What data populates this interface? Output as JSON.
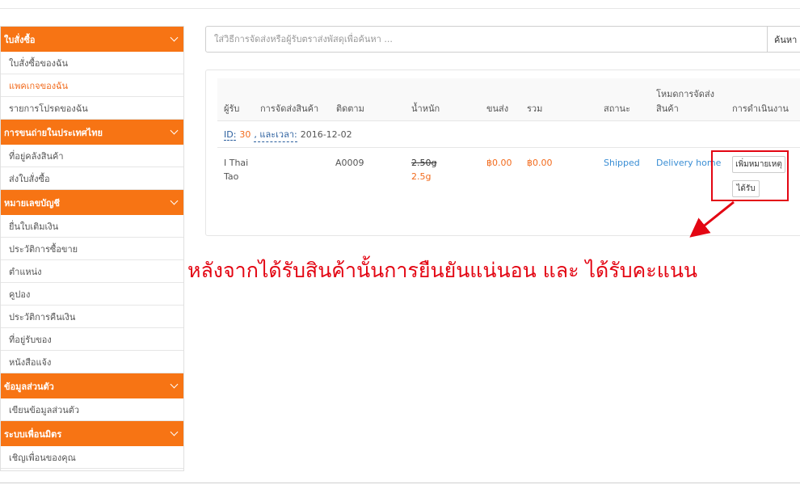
{
  "sidebar": {
    "sections": [
      {
        "title": "ใบสั่งซื้อ",
        "items": [
          "ใบสั่งซื้อของฉัน",
          "แพคเกจของฉัน",
          "รายการโปรดของฉัน"
        ]
      },
      {
        "title": "การขนถ่ายในประเทศไทย",
        "items": [
          "ที่อยู่คลังสินค้า",
          "ส่งใบสั่งซื้อ"
        ]
      },
      {
        "title": "หมายเลขบัญชี",
        "items": [
          "ยื่นใบเติมเงิน",
          "ประวัติการซื้อขาย",
          "ตำแหน่ง",
          "คูปอง",
          "ประวัติการคืนเงิน",
          "ที่อยู่รับของ",
          "หนังสือแจ้ง"
        ]
      },
      {
        "title": "ข้อมูลส่วนตัว",
        "items": [
          "เขียนข้อมูลส่วนตัว"
        ]
      },
      {
        "title": "ระบบเพื่อนมิตร",
        "items": [
          "เชิญเพื่อนของคุณ"
        ]
      }
    ],
    "active_item": "แพคเกจของฉัน"
  },
  "search": {
    "placeholder": "ใส่วิธีการจัดส่งหรือผู้รับตราส่งพัสดุเพื่อค้นหา ...",
    "button_label": "ค้นหา"
  },
  "table": {
    "headers": {
      "recipient": "ผู้รับ",
      "shipping": "การจัดส่งสินค้า",
      "tracking": "ติดตาม",
      "weight": "น้ำหนัก",
      "freight": "ขนส่ง",
      "total": "รวม",
      "status": "สถานะ",
      "delivery_mode_1": "โหมดการจัดส่ง",
      "delivery_mode_2": "สินค้า",
      "actions": "การดำเนินงาน"
    },
    "package": {
      "id_label": "ID:",
      "id": "30",
      "date_label": ", และเวลา:",
      "date": "2016-12-02"
    },
    "row": {
      "recipient_line1": "I Thai",
      "recipient_line2": "Tao",
      "tracking": "A0009",
      "weight_old": "2.50g",
      "weight_new": "2.5g",
      "freight": "฿0.00",
      "total": "฿0.00",
      "status": "Shipped",
      "delivery_mode": "Delivery home",
      "btn_add_note": "เพิ่มหมายเหตุ",
      "btn_received": "ได้รับ"
    }
  },
  "annotation": {
    "text": "หลังจากได้รับสินค้านั้นการยืนยันแน่นอน และ ได้รับคะแนน"
  },
  "colors": {
    "accent": "#f77414",
    "annotation_red": "#e30613",
    "link_blue": "#3a8ed4"
  }
}
